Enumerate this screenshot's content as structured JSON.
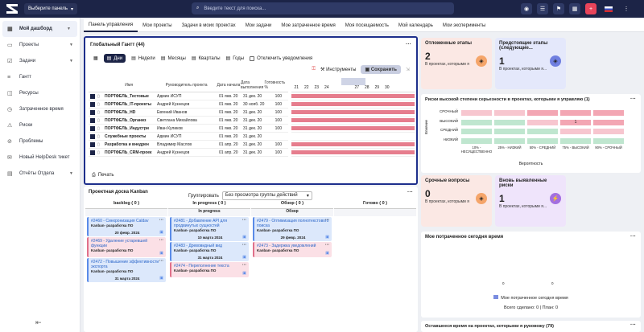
{
  "topbar": {
    "panel_select": "Выберите панель",
    "search_placeholder": "Введите текст для поиска...",
    "icons": [
      "user-icon",
      "settings-icon",
      "flag-icon",
      "calendar-icon",
      "add-icon",
      "language-flag-icon",
      "more-icon"
    ]
  },
  "sidebar": {
    "items": [
      {
        "label": "Мой дашборд",
        "icon": "grid-icon",
        "active": true,
        "chevron": true
      },
      {
        "label": "Проекты",
        "icon": "folder-icon",
        "chevron": true
      },
      {
        "label": "Задачи",
        "icon": "tasks-icon",
        "chevron": true
      },
      {
        "label": "Гантт",
        "icon": "gantt-icon"
      },
      {
        "label": "Ресурсы",
        "icon": "resources-icon"
      },
      {
        "label": "Затраченное время",
        "icon": "clock-icon"
      },
      {
        "label": "Риски",
        "icon": "risk-icon"
      },
      {
        "label": "Проблемы",
        "icon": "problem-icon"
      },
      {
        "label": "Новый HelpDesk тикет",
        "icon": "helpdesk-icon"
      },
      {
        "label": "Отчёты Отдела",
        "icon": "report-icon",
        "chevron": true
      }
    ]
  },
  "tabs": [
    "Панель управления",
    "Мои проекты",
    "Задачи в моих проектах",
    "Мои задачи",
    "Мое затраченное время",
    "Моя посещаемость",
    "Мой календарь",
    "Мои эксперименты"
  ],
  "gantt": {
    "title": "Глобальный Гантт (44)",
    "scales": [
      {
        "label": "Дни",
        "active": true
      },
      {
        "label": "Недели"
      },
      {
        "label": "Месяцы"
      },
      {
        "label": "Кварталы"
      },
      {
        "label": "Годы"
      }
    ],
    "notify_label": "Отключить уведомления",
    "tools_label": "Инструменты",
    "save_label": "Сохранить",
    "columns": [
      "Имя",
      "Руководитель проекта",
      "Дата начала",
      "Дата выполнения",
      "Готовность %"
    ],
    "rows": [
      {
        "name": "ПОРТФЕЛЬ_Тестовые",
        "manager": "Админ ИСУП",
        "start": "01 янв. 20",
        "end": "31 дек. 20",
        "pct": "100",
        "bar": true
      },
      {
        "name": "ПОРТФЕЛЬ_IT-проекты",
        "manager": "Андрей Кузнецов",
        "start": "01 янв. 20",
        "end": "30 нояб. 20",
        "pct": "100",
        "bar": true
      },
      {
        "name": "ПОРТФЕЛЬ_HD",
        "manager": "Евгений Иванов",
        "start": "01 янв. 20",
        "end": "31 дек. 20",
        "pct": "100",
        "bar": true
      },
      {
        "name": "ПОРТФЕЛЬ_Организ",
        "manager": "Светлана Михайлова",
        "start": "01 янв. 20",
        "end": "31 дек. 20",
        "pct": "100",
        "bar": true
      },
      {
        "name": "ПОРТФЕЛЬ_Индустри",
        "manager": "Иван Куликов",
        "start": "01 янв. 20",
        "end": "31 дек. 20",
        "pct": "100",
        "bar": true
      },
      {
        "name": "Служебные проекты",
        "manager": "Админ ИСУП",
        "start": "01 янв. 20",
        "end": "31 дек. 20",
        "pct": "",
        "bar": false
      },
      {
        "name": "Разработка и внедрен",
        "manager": "Владимир Маслов",
        "start": "01 апр. 20",
        "end": "31 дек. 20",
        "pct": "100",
        "bar": true
      },
      {
        "name": "ПОРТФЕЛЬ_CRM-проек",
        "manager": "Андрей Кузнецов",
        "start": "01 апр. 20",
        "end": "31 дек. 20",
        "pct": "100",
        "bar": true
      }
    ],
    "days": [
      "21",
      "22",
      "23",
      "24",
      "",
      "",
      "27",
      "28",
      "29",
      "30"
    ],
    "print_label": "Печать"
  },
  "kanban": {
    "title": "Проектная доска Kanban",
    "group_label": "Группировать",
    "group_value": "Без просмотра группы действий",
    "columns": [
      {
        "header": "backlog ( 0 )",
        "sub": "",
        "cards": [
          {
            "title": "#2460 - Синхронизация Caldav",
            "project": "Kanban- разработка ПО",
            "date": "20 февр. 2024",
            "color": "blue"
          },
          {
            "title": "#2469 - Удаление устаревшей функции",
            "project": "Kanban- разработка ПО",
            "date": "",
            "color": "pink"
          },
          {
            "title": "#2472 - Повышение эффективности экспорта",
            "project": "Kanban- разработка ПО",
            "date": "31 марта 2024",
            "color": "blue"
          }
        ]
      },
      {
        "header": "In progress ( 0 )",
        "sub": "In progress",
        "cards": [
          {
            "title": "#2481 - Добавление API для продвинутых сущностей",
            "project": "Kanban- разработка ПО",
            "date": "10 марта 2024",
            "color": "blue"
          },
          {
            "title": "#2483 - Древовидный вид",
            "project": "Kanban- разработка ПО",
            "date": "31 марта 2024",
            "color": "blue"
          },
          {
            "title": "#2474 - Переполнение текста",
            "project": "Kanban- разработка ПО",
            "date": "",
            "color": "pink"
          }
        ]
      },
      {
        "header": "Обзор ( 0 )",
        "sub": "Обзор",
        "cards": [
          {
            "title": "#2479 - Оптимизация полнотекстового поиска",
            "project": "Kanban- разработка ПО",
            "date": "29 февр. 2024",
            "color": "blue"
          },
          {
            "title": "#2473 - Задержка уведомлений",
            "project": "Kanban- разработка ПО",
            "date": "",
            "color": "pink"
          }
        ]
      },
      {
        "header": "Готово ( 0 )",
        "sub": "",
        "cards": []
      }
    ]
  },
  "tiles": [
    {
      "title": "Отложенные этапы",
      "num": "2",
      "sub": "В проектах, которыми я",
      "bg": "#fbe8e4",
      "icon_bg": "#f5a56a",
      "icon": "warning-icon"
    },
    {
      "title": "Предстоящие этапы (следующие...",
      "num": "1",
      "sub": "В проектах, которыми я...",
      "bg": "#e4e8fb",
      "icon_bg": "#6f7fe0",
      "icon": "upcoming-icon"
    },
    {
      "title": "Срочные вопросы",
      "num": "0",
      "sub": "В проектах, которыми я",
      "bg": "#fbe8e4",
      "icon_bg": "#f5a56a",
      "icon": "urgent-icon"
    },
    {
      "title": "Вновь выявленные риски",
      "num": "1",
      "sub": "В проектах, которыми я...",
      "bg": "#efe4fb",
      "icon_bg": "#a36fe0",
      "icon": "lightning-icon"
    }
  ],
  "risk": {
    "title": "Риски высокой степени серьезности в проектах, которыми я управляю (1)",
    "ylabel": "Влияние",
    "xlabel": "Вероятность",
    "rows": [
      "СРОЧНЫЙ",
      "ВЫСОКИЙ",
      "СРЕДНИЙ",
      "НИЗКИЙ"
    ],
    "cols": [
      "10% - НЕСУЩЕСТВЕННО",
      "25% - НИЗКИЙ",
      "50% - СРЕДНИЙ",
      "75% - ВЫСОКИЙ",
      "90% - СРОЧНЫЙ"
    ],
    "values": [
      [
        "",
        "",
        "",
        "",
        ""
      ],
      [
        "",
        "",
        "",
        "1",
        ""
      ],
      [
        "",
        "",
        "",
        "",
        ""
      ],
      [
        "",
        "",
        "",
        "",
        ""
      ]
    ]
  },
  "mytime": {
    "title": "Мое потраченное сегодня время",
    "axis_zero": "0",
    "legend": "Мое потраченное сегодня время",
    "total": "Всего сделано: 0 | План: 0"
  },
  "remain": {
    "title": "Оставшееся время на проектах, которыми я руковожу (79)"
  }
}
